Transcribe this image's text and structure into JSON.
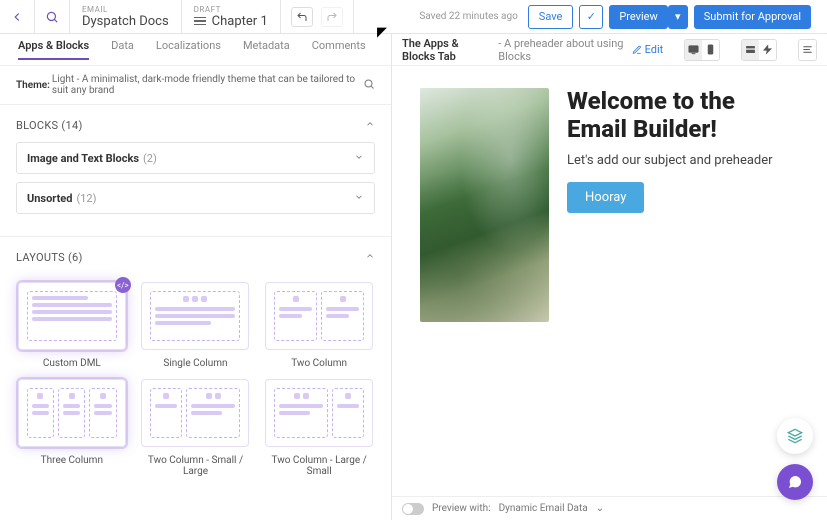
{
  "topbar": {
    "email_label": "EMAIL",
    "email_value": "Dyspatch Docs",
    "draft_label": "DRAFT",
    "draft_value": "Chapter 1",
    "saved_text": "Saved 22 minutes ago",
    "save": "Save",
    "preview": "Preview",
    "submit": "Submit for Approval",
    "check": "✓",
    "caret": "▾"
  },
  "tabs": {
    "items": [
      "Apps & Blocks",
      "Data",
      "Localizations",
      "Metadata",
      "Comments"
    ],
    "active": 0
  },
  "theme": {
    "label": "Theme:",
    "value": "Light - A minimalist, dark-mode friendly theme that can be tailored to suit any brand"
  },
  "blocks": {
    "title": "BLOCKS (14)",
    "groups": [
      {
        "name": "Image and Text Blocks",
        "count": "(2)"
      },
      {
        "name": "Unsorted",
        "count": "(12)"
      }
    ]
  },
  "layouts": {
    "title": "LAYOUTS (6)",
    "items": [
      "Custom DML",
      "Single Column",
      "Two Column",
      "Three Column",
      "Two Column - Small / Large",
      "Two Column - Large / Small"
    ]
  },
  "preview_header": {
    "title": "The Apps & Blocks Tab",
    "subtitle": "- A preheader about using Blocks",
    "edit": "Edit"
  },
  "email": {
    "heading": "Welcome to the Email Builder!",
    "body": "Let's add our subject and preheader",
    "cta": "Hooray"
  },
  "footer": {
    "label": "Preview with:",
    "value": "Dynamic Email Data"
  }
}
